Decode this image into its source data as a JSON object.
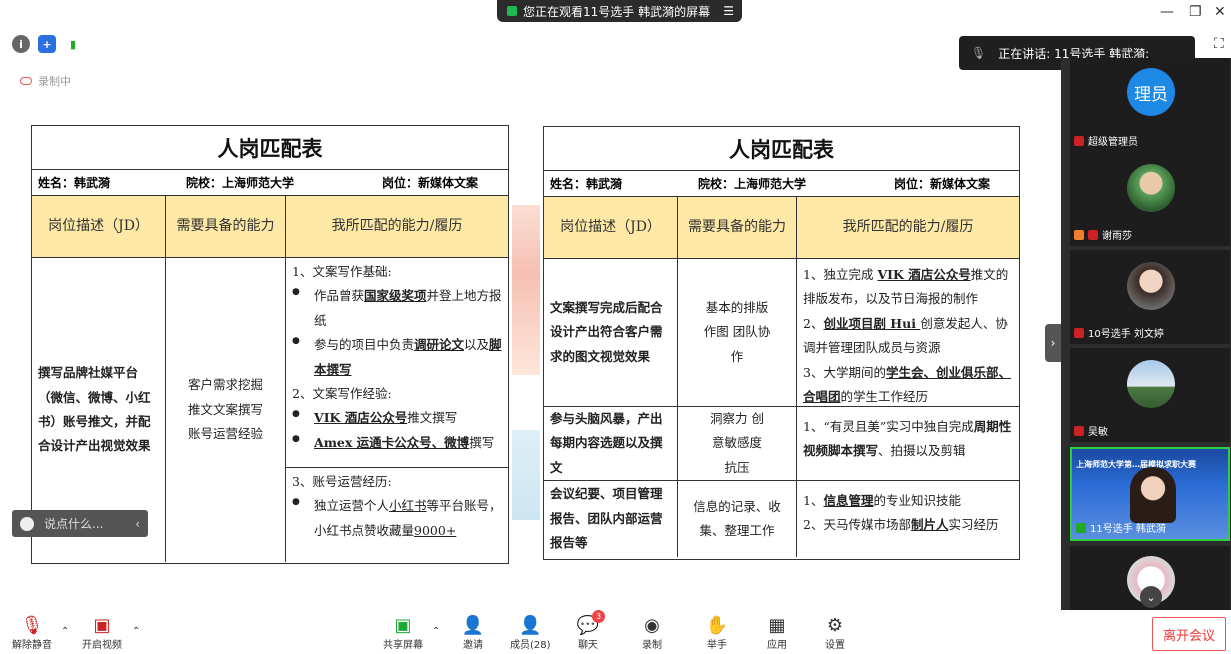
{
  "banner": {
    "text": "您正在观看11号选手 韩武漪的屏幕",
    "menu_icon": "menu-icon"
  },
  "window": {
    "minimize": "—",
    "restore": "❐",
    "close": "✕"
  },
  "status_icons": [
    "info-icon",
    "shield-icon",
    "signal-icon"
  ],
  "recording": {
    "label": "录制中"
  },
  "speaking": {
    "text": "正在讲话: 11号选手 韩武漪;"
  },
  "tables": [
    {
      "title": "人岗匹配表",
      "info": {
        "name": "姓名：韩武漪",
        "school": "院校：上海师范大学",
        "position": "岗位：新媒体文案"
      },
      "headers": [
        "岗位描述（JD）",
        "需要具备的能力",
        "我所匹配的能力/履历"
      ],
      "rows": [
        {
          "jd": "撰写品牌社媒平台（微信、微博、小红书）账号推文，并配合设计产出视觉效果",
          "ability": "客户需求挖掘 推文文案撰写 账号运营经验",
          "match_1_title": "1、文案写作基础:",
          "match_1_b1_a": "作品曾获",
          "match_1_b1_u": "国家级奖项",
          "match_1_b1_b": "并登上地方报纸",
          "match_1_b2_a": "参与的项目中负责",
          "match_1_b2_u": "调研论文",
          "match_1_b2_b": "以及",
          "match_1_b2_u2": "脚本撰写",
          "match_2_title": "2、文案写作经验:",
          "match_2_b1_u": "VIK 酒店公众号",
          "match_2_b1_b": "推文撰写",
          "match_2_b2_u": "Amex 运通卡公众号、微博",
          "match_2_b2_b": "撰写",
          "match_3_title": "3、账号运营经历:",
          "match_3_b1_a": "独立运营个人",
          "match_3_b1_u": "小红书",
          "match_3_b1_b": "等平台账号，小红书点赞收藏量",
          "match_3_b1_u2": "9000+"
        }
      ]
    },
    {
      "title": "人岗匹配表",
      "info": {
        "name": "姓名：韩武漪",
        "school": "院校：上海师范大学",
        "position": "岗位：新媒体文案"
      },
      "headers": [
        "岗位描述（JD）",
        "需要具备的能力",
        "我所匹配的能力/履历"
      ],
      "rows": [
        {
          "jd": "文案撰写完成后配合设计产出符合客户需求的图文视觉效果",
          "ability": "基本的排版作图 团队协作",
          "m1_a": "1、独立完成 ",
          "m1_u": "VIK 酒店公众号",
          "m1_b": "推文的排版发布，以及节日海报的制作",
          "m2_a": "2、",
          "m2_u": "创业项目剧 Hui ",
          "m2_b": "创意发起人、协调并管理团队成员与资源",
          "m3_a": "3、大学期间的",
          "m3_u": "学生会、创业俱乐部、合唱团",
          "m3_b": "的学生工作经历"
        },
        {
          "jd": "参与头脑风暴，产出每期内容选题以及撰文",
          "ability": "洞察力 创意敏感度 抗压",
          "m1_a": "1、“有灵且美”实习中独自完成",
          "m1_bold": "周期性视频脚本撰写",
          "m1_b": "、拍摄以及剪辑"
        },
        {
          "jd": "会议纪要、项目管理报告、团队内部运营报告等",
          "ability": "信息的记录、收集、整理工作",
          "m1_a": "1、",
          "m1_u": "信息管理",
          "m1_b": "的专业知识技能",
          "m2_a": "2、天马传媒市场部",
          "m2_u": "制片人",
          "m2_b": "实习经历"
        }
      ]
    }
  ],
  "chat": {
    "placeholder": "说点什么..."
  },
  "participants": [
    {
      "name": "超级管理员",
      "avatar_text": "理员",
      "avatar_color": "#1e88e5"
    },
    {
      "name": "谢雨莎"
    },
    {
      "name": "10号选手 刘文婷"
    },
    {
      "name": "吴敏"
    },
    {
      "name": "11号选手 韩武漪",
      "banner": "上海师范大学第…届模拟求职大赛"
    },
    {
      "name": ""
    }
  ],
  "toolbar": {
    "mute": "解除静音",
    "video": "开启视频",
    "share": "共享屏幕",
    "invite": "邀请",
    "members": "成员(28)",
    "chat": "聊天",
    "chat_badge": "3",
    "record": "录制",
    "raise_hand": "举手",
    "apps": "应用",
    "settings": "设置",
    "leave": "离开会议"
  }
}
